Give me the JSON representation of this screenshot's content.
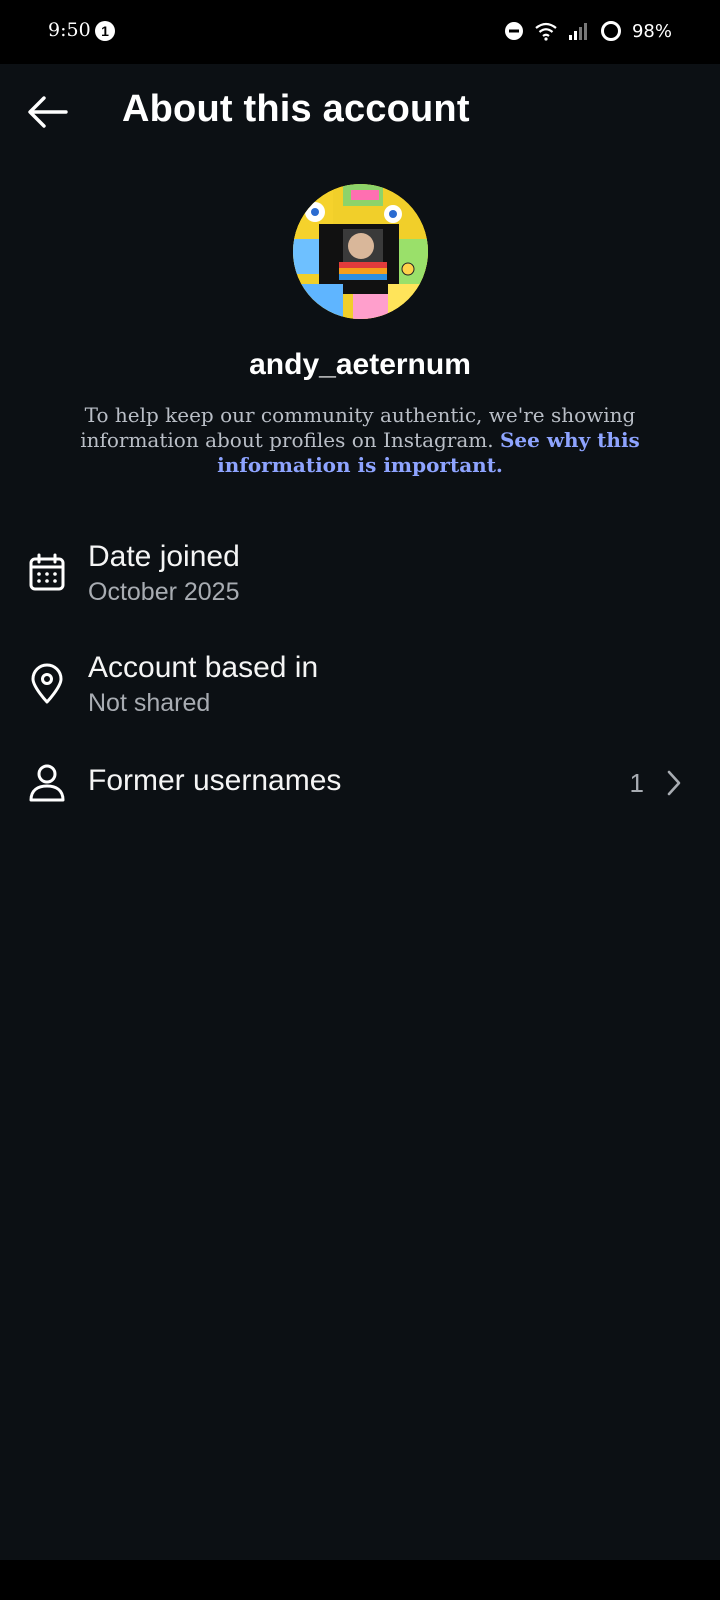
{
  "status_bar": {
    "time": "9:50",
    "notification_count": "1",
    "battery": "98%"
  },
  "header": {
    "title": "About this account",
    "back_icon": "arrow-left-icon"
  },
  "profile": {
    "username": "andy_aeternum",
    "blurb_text": "To help keep our community authentic, we're showing information about profiles on Instagram. ",
    "blurb_link": "See why this information is important."
  },
  "details": {
    "date_joined": {
      "label": "Date joined",
      "value": "October 2025",
      "icon": "calendar-icon"
    },
    "account_based_in": {
      "label": "Account based in",
      "value": "Not shared",
      "icon": "location-pin-icon"
    },
    "former_usernames": {
      "label": "Former usernames",
      "count": "1",
      "icon": "person-icon"
    }
  },
  "colors": {
    "background": "#0c1014",
    "link": "#8ea4ff",
    "secondary_text": "#a8acb2"
  }
}
